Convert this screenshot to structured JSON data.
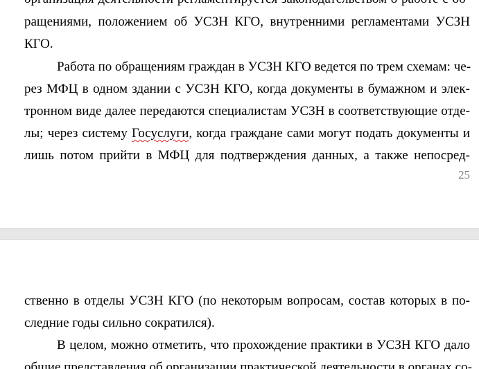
{
  "document": {
    "page_top": {
      "lines": [
        "организация деятельности регламентируется законодательством о работе с об-",
        "ращениями, положением об УСЗН КГО, внутренними регламентами УСЗН",
        "КГО.",
        "Работа по обращениям граждан в УСЗН КГО ведется по трем схемам: че-",
        "рез МФЦ в одном здании с УСЗН КГО, когда документы в бумажном и элек-",
        "тронном виде далее передаются специалистам УСЗН в соответствующие отде-"
      ],
      "line7": {
        "before": "лы; через систему ",
        "flagged_word": "Госуслуги",
        "after": ", когда граждане сами могут подать документы и"
      },
      "line8": "лишь потом прийти в МФЦ для подтверждения данных, а также непосред-",
      "page_number": "25"
    },
    "page_bottom": {
      "lines": [
        "ственно в отделы УСЗН КГО (по некоторым вопросам, состав которых в по-",
        "следние годы сильно сократился).",
        "В целом, можно отметить, что прохождение практики в УСЗН КГО дало",
        "общие представления об организации практической деятельности в органах со-"
      ]
    }
  }
}
